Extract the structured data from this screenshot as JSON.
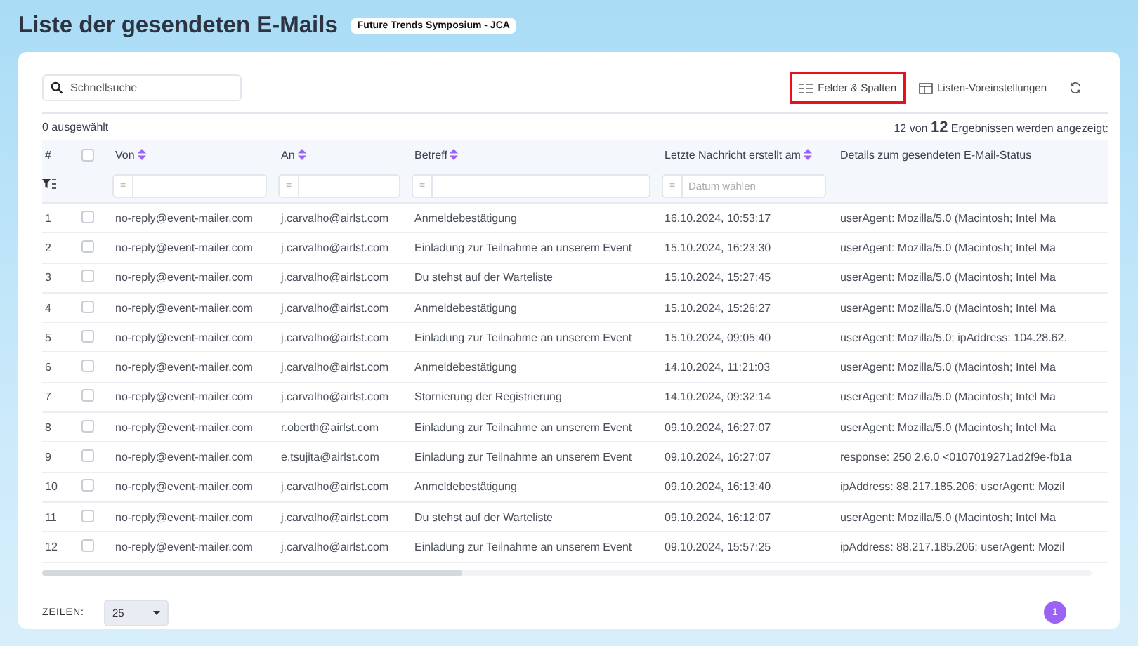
{
  "page": {
    "title": "Liste der gesendeten E-Mails",
    "event_badge": "Future Trends Symposium - JCA"
  },
  "toolbar": {
    "search": {
      "placeholder": "Schnellsuche"
    },
    "buttons": [
      {
        "label": "Felder & Spalten",
        "kind": "fields",
        "highlighted": true
      },
      {
        "label": "Listen-Voreinstellungen",
        "kind": "presets",
        "highlighted": false
      },
      {
        "kind": "refresh"
      }
    ]
  },
  "selection_count": "0 ausgewählt",
  "result_summary": {
    "before": "12 von",
    "count": "12",
    "after": "Ergebnissen werden angezeigt:"
  },
  "table": {
    "index_header": "#",
    "select_all": {
      "checked": false
    },
    "columns": [
      {
        "label": "Von",
        "kind": "text",
        "sortable": true,
        "filter": {
          "operator": "="
        }
      },
      {
        "label": "An",
        "kind": "text",
        "sortable": true,
        "filter": {
          "operator": "="
        }
      },
      {
        "label": "Betreff",
        "kind": "text",
        "sortable": true,
        "filter": {
          "operator": "="
        }
      },
      {
        "label": "Letzte Nachricht erstellt am",
        "kind": "text",
        "sortable": true,
        "filter": {
          "operator": "=",
          "placeholder": "Datum wählen"
        }
      },
      {
        "label": "Details zum gesendeten E-Mail-Status",
        "kind": "text",
        "sortable": false
      }
    ],
    "rows": [
      {
        "number": "1",
        "checked": false,
        "cells": [
          "no-reply@event-mailer.com",
          "j.carvalho@airlst.com",
          "Anmeldebestätigung",
          "16.10.2024, 10:53:17",
          "userAgent: Mozilla/5.0 (Macintosh; Intel Ma"
        ]
      },
      {
        "number": "2",
        "checked": false,
        "cells": [
          "no-reply@event-mailer.com",
          "j.carvalho@airlst.com",
          "Einladung zur Teilnahme an unserem Event",
          "15.10.2024, 16:23:30",
          "userAgent: Mozilla/5.0 (Macintosh; Intel Ma"
        ]
      },
      {
        "number": "3",
        "checked": false,
        "cells": [
          "no-reply@event-mailer.com",
          "j.carvalho@airlst.com",
          "Du stehst auf der Warteliste",
          "15.10.2024, 15:27:45",
          "userAgent: Mozilla/5.0 (Macintosh; Intel Ma"
        ]
      },
      {
        "number": "4",
        "checked": false,
        "cells": [
          "no-reply@event-mailer.com",
          "j.carvalho@airlst.com",
          "Anmeldebestätigung",
          "15.10.2024, 15:26:27",
          "userAgent: Mozilla/5.0 (Macintosh; Intel Ma"
        ]
      },
      {
        "number": "5",
        "checked": false,
        "cells": [
          "no-reply@event-mailer.com",
          "j.carvalho@airlst.com",
          "Einladung zur Teilnahme an unserem Event",
          "15.10.2024, 09:05:40",
          "userAgent: Mozilla/5.0; ipAddress: 104.28.62."
        ]
      },
      {
        "number": "6",
        "checked": false,
        "cells": [
          "no-reply@event-mailer.com",
          "j.carvalho@airlst.com",
          "Anmeldebestätigung",
          "14.10.2024, 11:21:03",
          "userAgent: Mozilla/5.0 (Macintosh; Intel Ma"
        ]
      },
      {
        "number": "7",
        "checked": false,
        "cells": [
          "no-reply@event-mailer.com",
          "j.carvalho@airlst.com",
          "Stornierung der Registrierung",
          "14.10.2024, 09:32:14",
          "userAgent: Mozilla/5.0 (Macintosh; Intel Ma"
        ]
      },
      {
        "number": "8",
        "checked": false,
        "cells": [
          "no-reply@event-mailer.com",
          "r.oberth@airlst.com",
          "Einladung zur Teilnahme an unserem Event",
          "09.10.2024, 16:27:07",
          "userAgent: Mozilla/5.0 (Macintosh; Intel Ma"
        ]
      },
      {
        "number": "9",
        "checked": false,
        "cells": [
          "no-reply@event-mailer.com",
          "e.tsujita@airlst.com",
          "Einladung zur Teilnahme an unserem Event",
          "09.10.2024, 16:27:07",
          "response: 250 2.6.0 <0107019271ad2f9e-fb1a"
        ]
      },
      {
        "number": "10",
        "checked": false,
        "cells": [
          "no-reply@event-mailer.com",
          "j.carvalho@airlst.com",
          "Anmeldebestätigung",
          "09.10.2024, 16:13:40",
          "ipAddress: 88.217.185.206; userAgent: Mozil"
        ]
      },
      {
        "number": "11",
        "checked": false,
        "cells": [
          "no-reply@event-mailer.com",
          "j.carvalho@airlst.com",
          "Du stehst auf der Warteliste",
          "09.10.2024, 16:12:07",
          "userAgent: Mozilla/5.0 (Macintosh; Intel Ma"
        ]
      },
      {
        "number": "12",
        "checked": false,
        "cells": [
          "no-reply@event-mailer.com",
          "j.carvalho@airlst.com",
          "Einladung zur Teilnahme an unserem Event",
          "09.10.2024, 15:57:25",
          "ipAddress: 88.217.185.206; userAgent: Mozil"
        ]
      }
    ]
  },
  "footer": {
    "rows_label": "ZEILEN:",
    "page_size": "25",
    "pages": [
      {
        "label": "1",
        "selected": true
      }
    ]
  }
}
